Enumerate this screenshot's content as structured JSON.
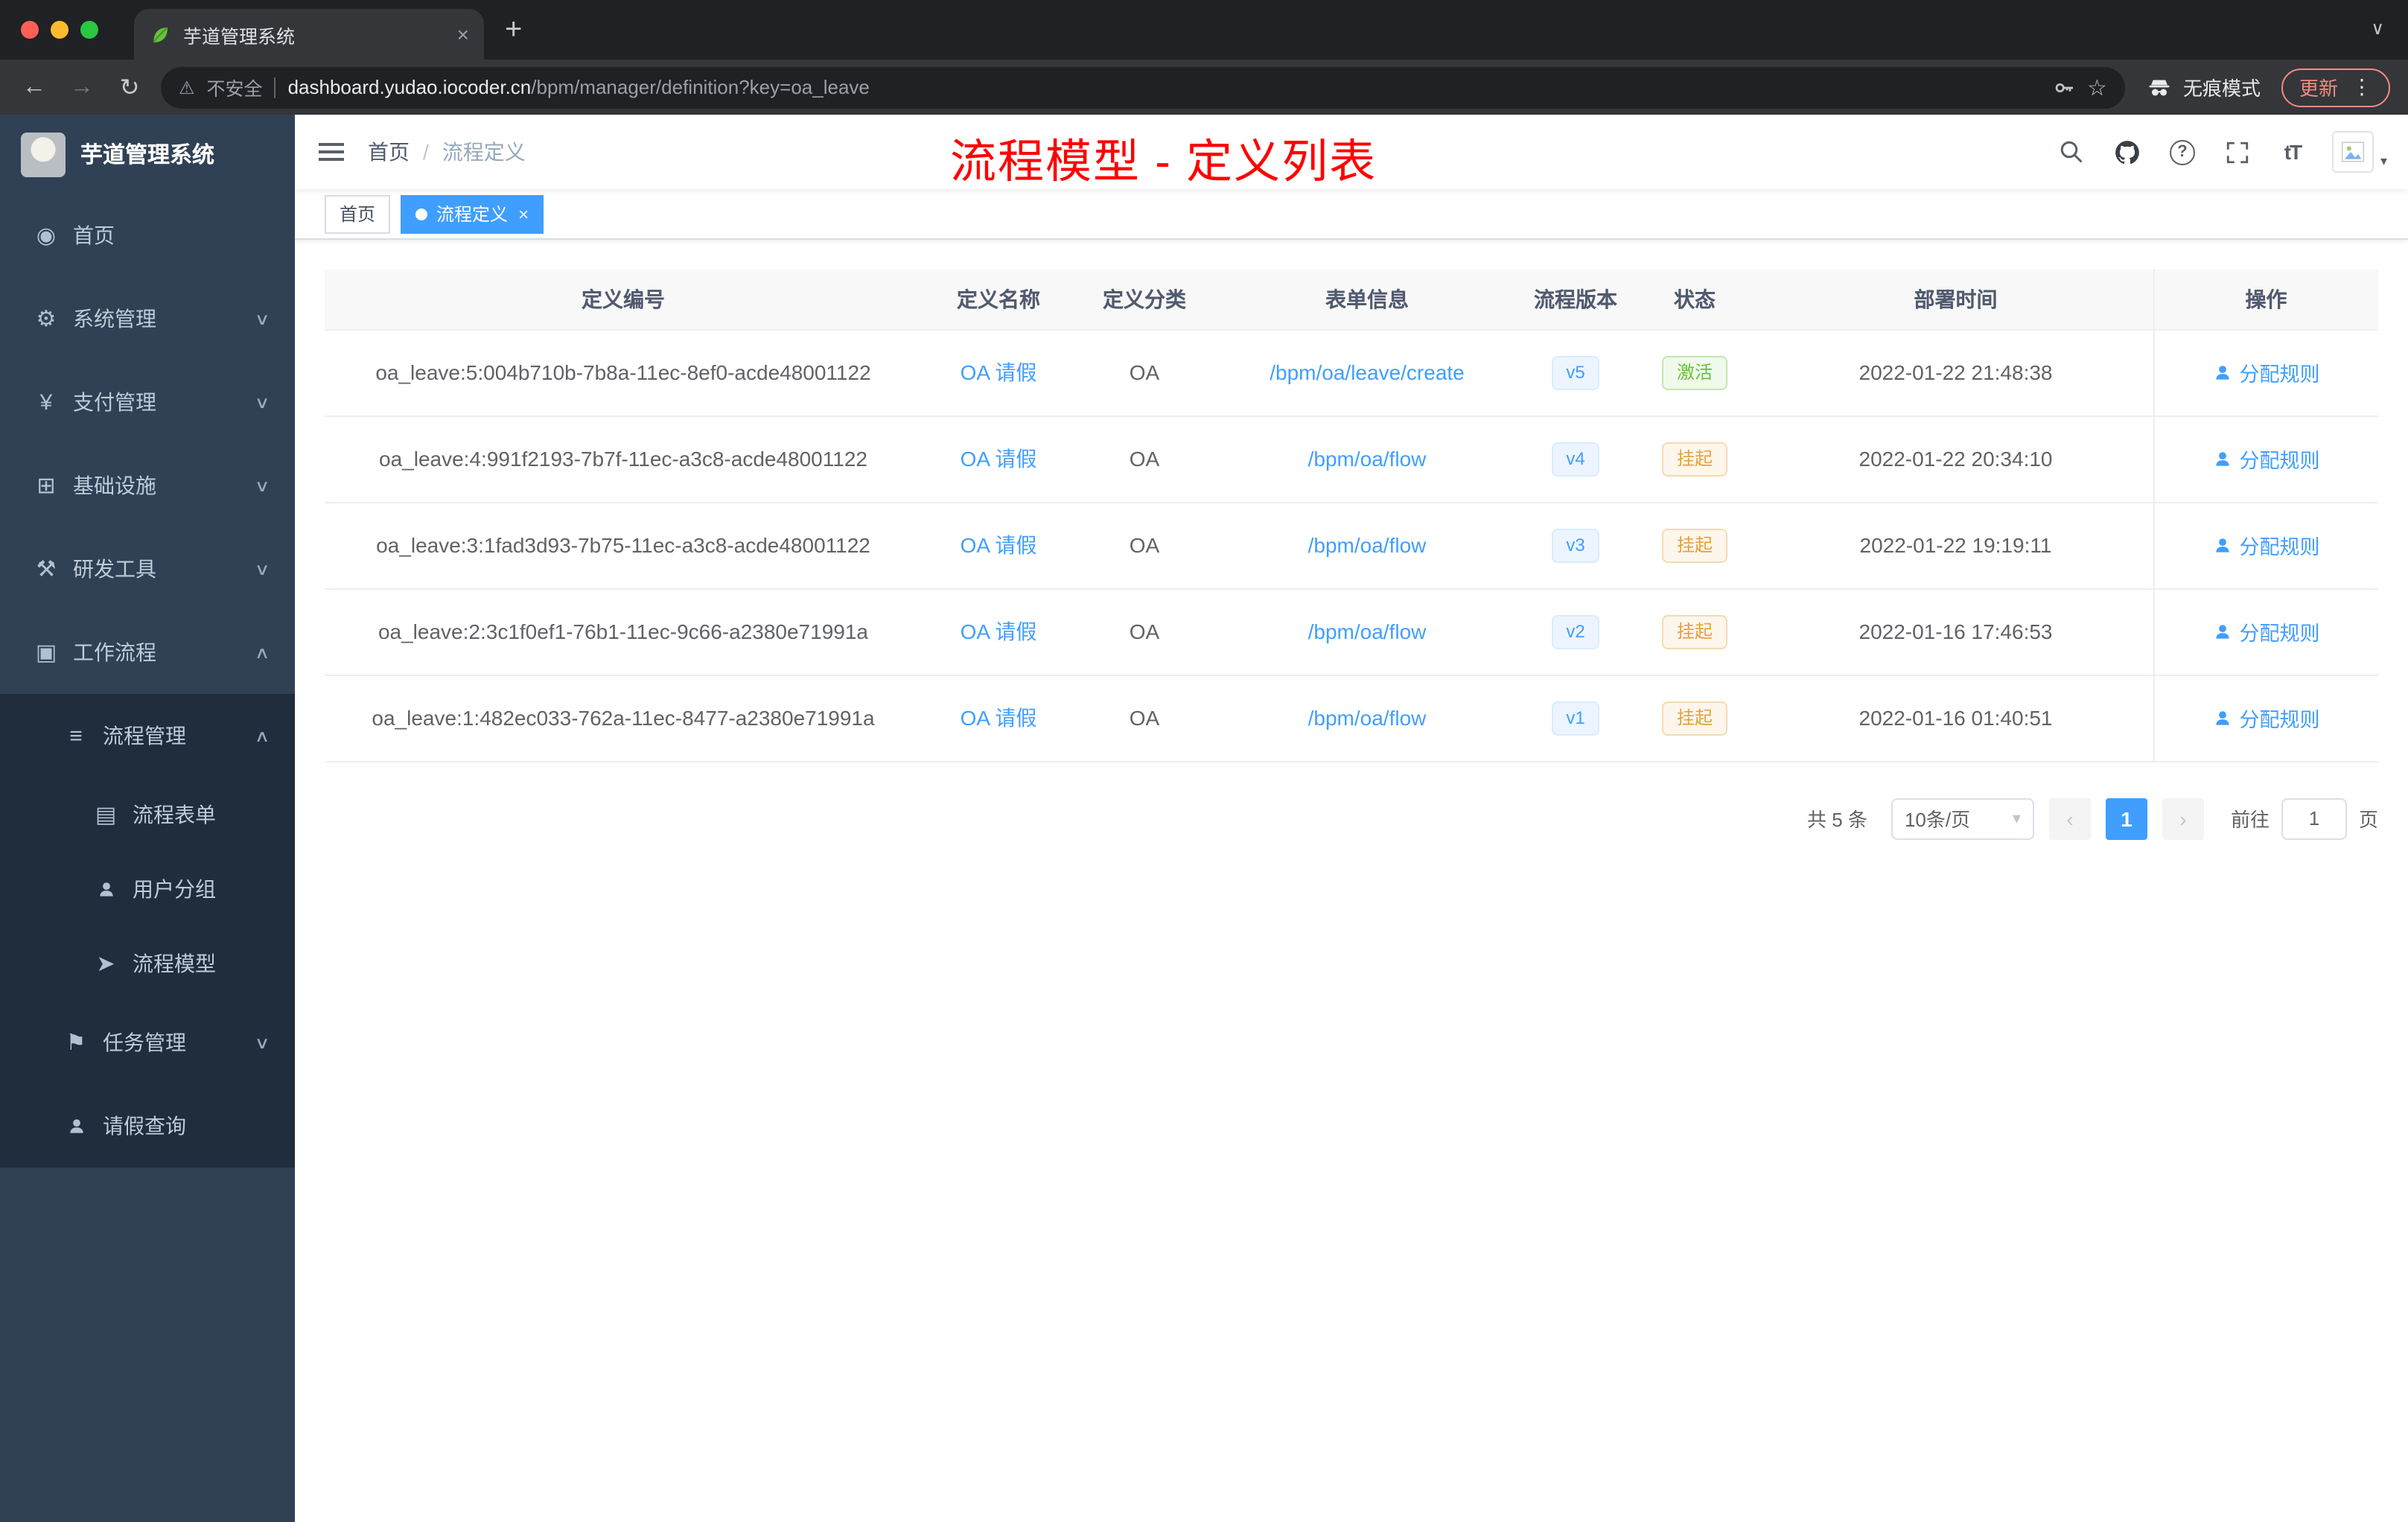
{
  "browser": {
    "tab_title": "芋道管理系统",
    "security_label": "不安全",
    "url_domain": "dashboard.yudao.iocoder.cn",
    "url_path": "/bpm/manager/definition?key=oa_leave",
    "incognito_label": "无痕模式",
    "update_label": "更新"
  },
  "sidebar": {
    "logo_title": "芋道管理系统",
    "items": [
      {
        "label": "首页"
      },
      {
        "label": "系统管理"
      },
      {
        "label": "支付管理"
      },
      {
        "label": "基础设施"
      },
      {
        "label": "研发工具"
      },
      {
        "label": "工作流程"
      },
      {
        "label": "流程管理"
      },
      {
        "label": "流程表单"
      },
      {
        "label": "用户分组"
      },
      {
        "label": "流程模型"
      },
      {
        "label": "任务管理"
      },
      {
        "label": "请假查询"
      }
    ]
  },
  "navbar": {
    "breadcrumb_home": "首页",
    "breadcrumb_separator": "/",
    "breadcrumb_current": "流程定义",
    "annotation": "流程模型 - 定义列表"
  },
  "tags": [
    {
      "label": "首页"
    },
    {
      "label": "流程定义"
    }
  ],
  "table": {
    "headers": [
      "定义编号",
      "定义名称",
      "定义分类",
      "表单信息",
      "流程版本",
      "状态",
      "部署时间",
      "操作"
    ],
    "rows": [
      {
        "id": "oa_leave:5:004b710b-7b8a-11ec-8ef0-acde48001122",
        "name": "OA 请假",
        "category": "OA",
        "form": "/bpm/oa/leave/create",
        "version": "v5",
        "status": "激活",
        "status_type": "success",
        "deploy_time": "2022-01-22 21:48:38",
        "action": "分配规则"
      },
      {
        "id": "oa_leave:4:991f2193-7b7f-11ec-a3c8-acde48001122",
        "name": "OA 请假",
        "category": "OA",
        "form": "/bpm/oa/flow",
        "version": "v4",
        "status": "挂起",
        "status_type": "warning",
        "deploy_time": "2022-01-22 20:34:10",
        "action": "分配规则"
      },
      {
        "id": "oa_leave:3:1fad3d93-7b75-11ec-a3c8-acde48001122",
        "name": "OA 请假",
        "category": "OA",
        "form": "/bpm/oa/flow",
        "version": "v3",
        "status": "挂起",
        "status_type": "warning",
        "deploy_time": "2022-01-22 19:19:11",
        "action": "分配规则"
      },
      {
        "id": "oa_leave:2:3c1f0ef1-76b1-11ec-9c66-a2380e71991a",
        "name": "OA 请假",
        "category": "OA",
        "form": "/bpm/oa/flow",
        "version": "v2",
        "status": "挂起",
        "status_type": "warning",
        "deploy_time": "2022-01-16 17:46:53",
        "action": "分配规则"
      },
      {
        "id": "oa_leave:1:482ec033-762a-11ec-8477-a2380e71991a",
        "name": "OA 请假",
        "category": "OA",
        "form": "/bpm/oa/flow",
        "version": "v1",
        "status": "挂起",
        "status_type": "warning",
        "deploy_time": "2022-01-16 01:40:51",
        "action": "分配规则"
      }
    ]
  },
  "pagination": {
    "total": "共 5 条",
    "page_size": "10条/页",
    "current_page": "1",
    "goto_label": "前往",
    "goto_value": "1",
    "goto_unit": "页"
  },
  "icons": {
    "back": "←",
    "forward": "→",
    "reload": "↻",
    "warning": "⚠",
    "star": "☆",
    "menu_dots": "⋮",
    "new_tab": "+",
    "close": "×",
    "tab_search": "∨",
    "chevron_down": "∨",
    "chevron_up": "∧",
    "select_caret": "▾",
    "page_prev": "‹",
    "page_next": "›",
    "dashboard": "◉",
    "gear": "⚙",
    "yen": "¥",
    "infra": "⊞",
    "tools": "⚒",
    "workflow": "▣",
    "list": "≡",
    "form": "▤",
    "send": "➤",
    "flag": "⚑",
    "question": "?",
    "font_size": "tT"
  },
  "colors": {
    "accent": "#409eff",
    "annotation_red": "#ff0000",
    "success": "#67c23a",
    "warning": "#e6a23c",
    "sidebar_bg": "#304156",
    "submenu_bg": "#1f2d3d",
    "table_header_bg": "#f8f8f9"
  }
}
